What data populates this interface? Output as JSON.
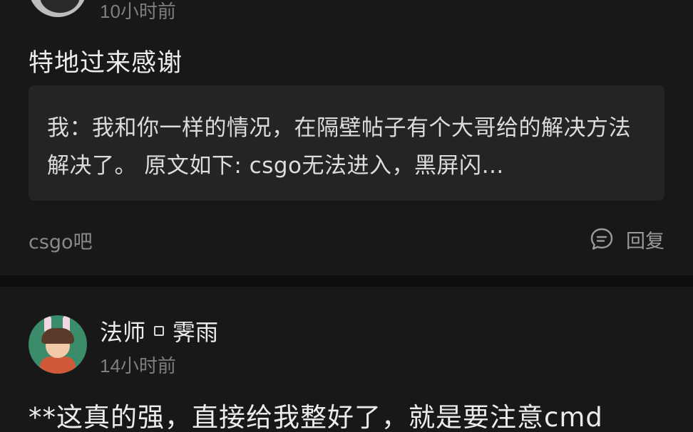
{
  "comments": [
    {
      "time": "10小时前",
      "text": "特地过来感谢",
      "quote": "我：我和你一样的情况，在隔壁帖子有个大哥给的解决方法解决了。 原文如下: csgo无法进入，黑屏闪…",
      "forum": "csgo吧",
      "reply_label": "回复"
    },
    {
      "user_name": "法师",
      "user_suffix": "霁雨",
      "time": "14小时前",
      "text": "**这真的强，直接给我整好了，就是要注意cmd"
    }
  ],
  "colors": {
    "background": "#0f0f0f",
    "card": "#181818",
    "quote_bg": "#242424",
    "muted_text": "#7e7e7e"
  },
  "icons": {
    "reply": "speech-bubble-icon",
    "badge": "square-badge-icon"
  }
}
